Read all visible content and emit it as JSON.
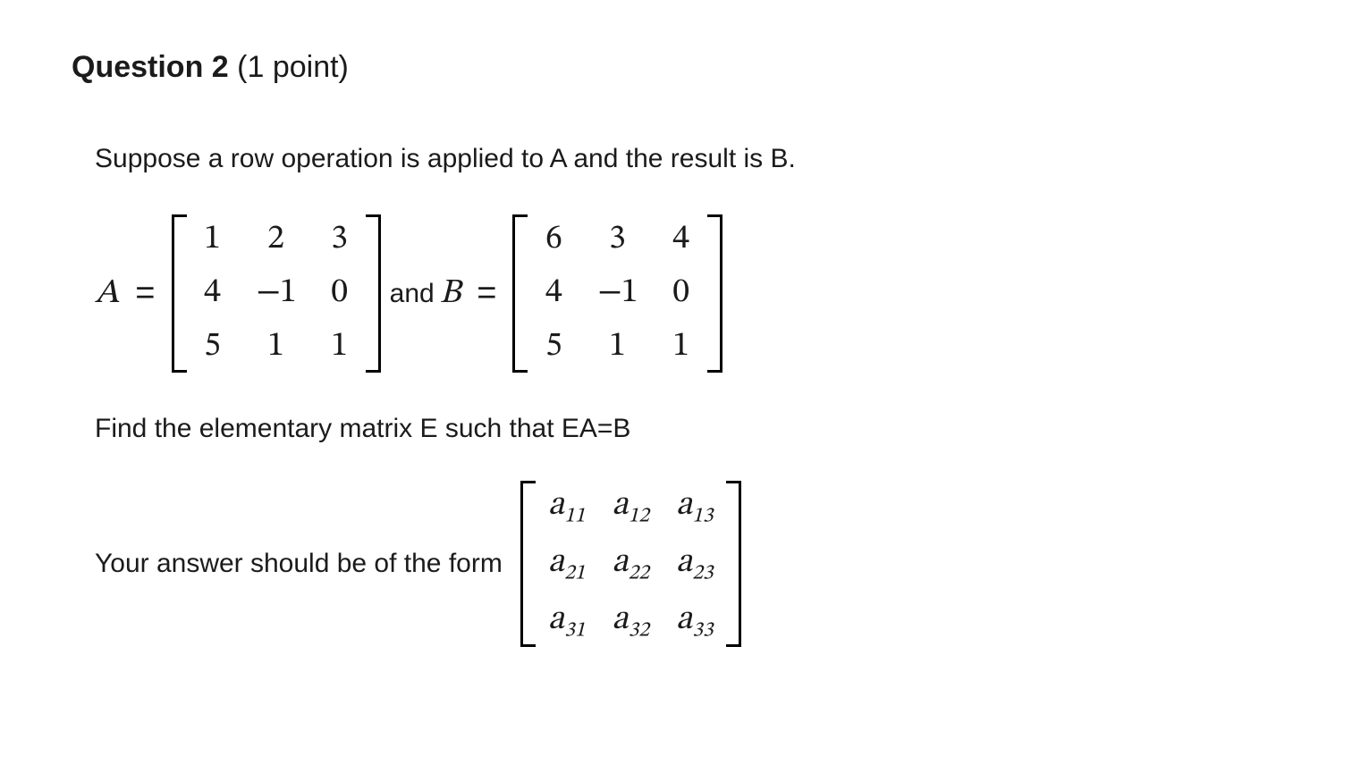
{
  "question": {
    "label": "Question 2",
    "points": "(1 point)"
  },
  "text": {
    "intro": "Suppose a row operation is applied to A and the result is B.",
    "mid": "Find the elementary matrix E such that EA=B",
    "answer_lead": "Your answer should be of the form",
    "and": "and"
  },
  "var": {
    "A": "A",
    "B": "B",
    "eq": "="
  },
  "matrixA": {
    "r1c1": "1",
    "r1c2": "2",
    "r1c3": "3",
    "r2c1": "4",
    "r2c2": "−1",
    "r2c3": "0",
    "r3c1": "5",
    "r3c2": "1",
    "r3c3": "1"
  },
  "matrixB": {
    "r1c1": "6",
    "r1c2": "3",
    "r1c3": "4",
    "r2c1": "4",
    "r2c2": "−1",
    "r2c3": "0",
    "r3c1": "5",
    "r3c2": "1",
    "r3c3": "1"
  },
  "matrixE": {
    "r1c1_base": "a",
    "r1c1_sub": "11",
    "r1c2_base": "a",
    "r1c2_sub": "12",
    "r1c3_base": "a",
    "r1c3_sub": "13",
    "r2c1_base": "a",
    "r2c1_sub": "21",
    "r2c2_base": "a",
    "r2c2_sub": "22",
    "r2c3_base": "a",
    "r2c3_sub": "23",
    "r3c1_base": "a",
    "r3c1_sub": "31",
    "r3c2_base": "a",
    "r3c2_sub": "32",
    "r3c3_base": "a",
    "r3c3_sub": "33"
  }
}
